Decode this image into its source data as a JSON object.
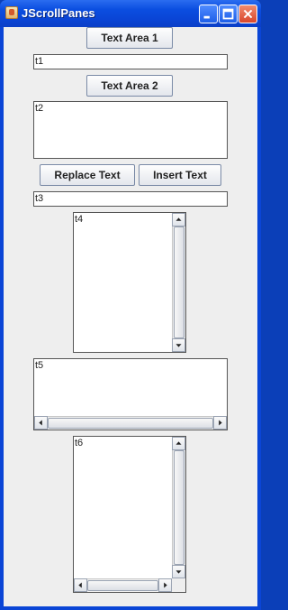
{
  "window": {
    "title": "JScrollPanes"
  },
  "buttons": {
    "text_area_1": "Text Area 1",
    "text_area_2": "Text Area 2",
    "replace_text": "Replace Text",
    "insert_text": "Insert Text"
  },
  "fields": {
    "t1": "t1",
    "t2": "t2",
    "t3": "t3",
    "t4": "t4",
    "t5": "t5",
    "t6": "t6"
  },
  "icons": [
    "java-app-icon",
    "minimize-icon",
    "maximize-icon",
    "close-icon",
    "arrow-up-icon",
    "arrow-down-icon",
    "arrow-left-icon",
    "arrow-right-icon"
  ]
}
